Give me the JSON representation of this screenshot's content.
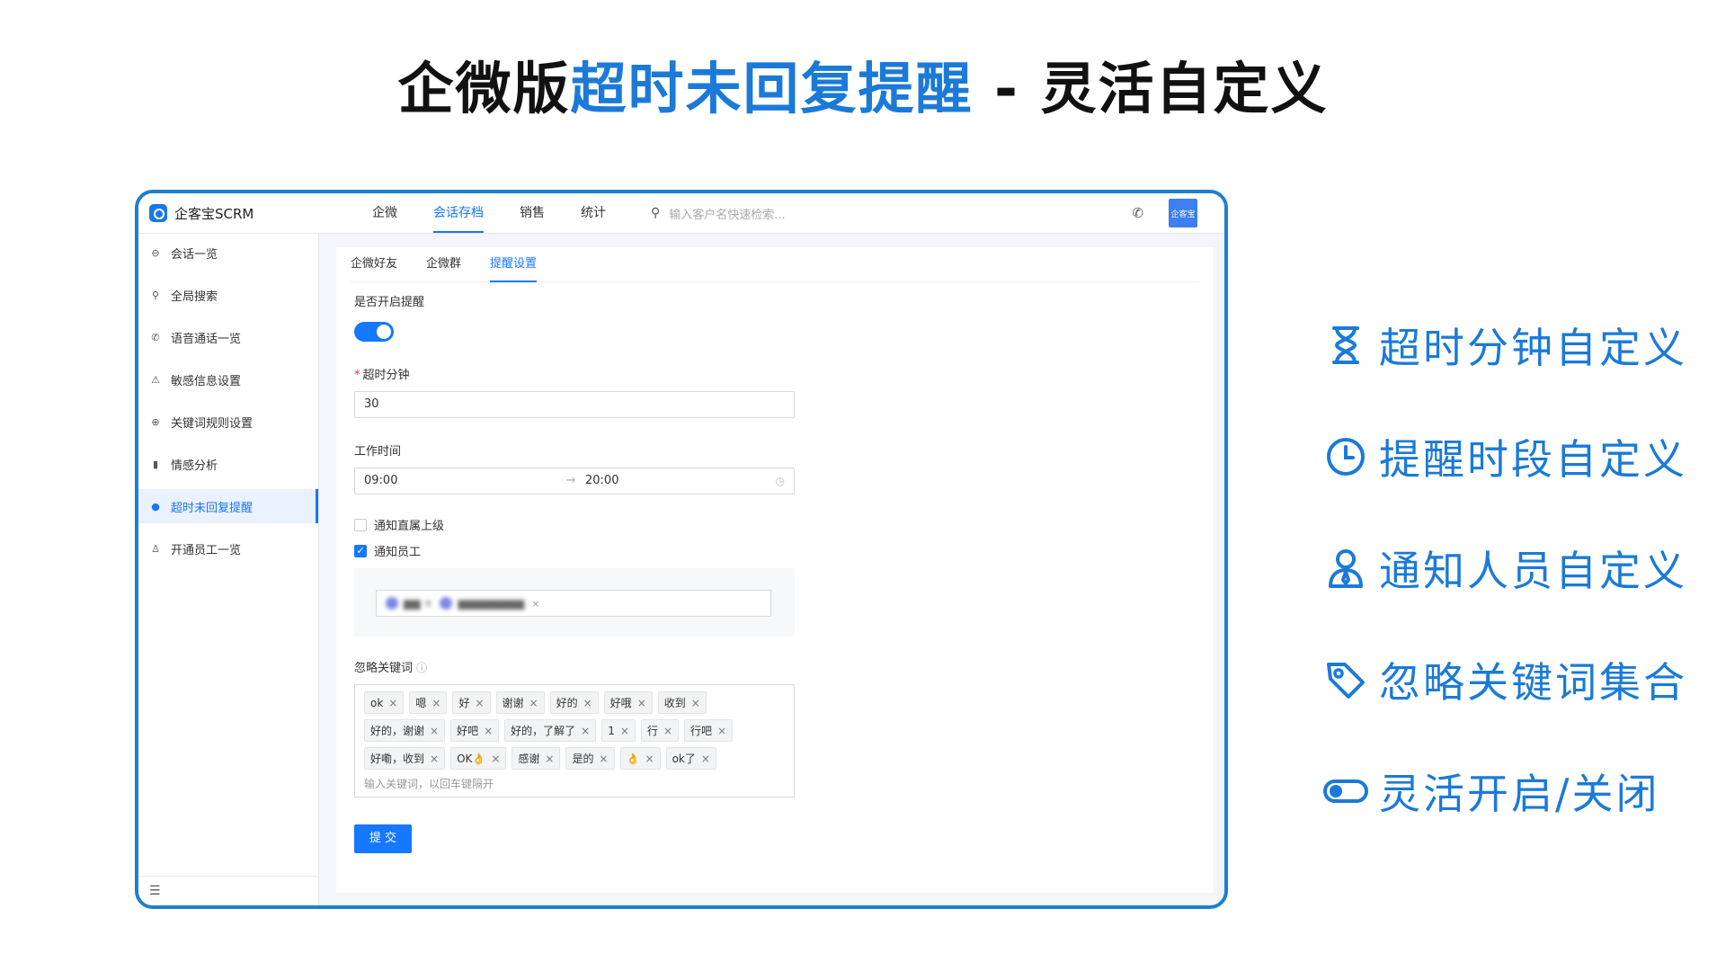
{
  "title": {
    "prefix": "企微版",
    "highlight": "超时未回复提醒",
    "suffix": " - 灵活自定义"
  },
  "app": {
    "logo_text": "企客宝SCRM",
    "top_nav": [
      "企微",
      "会话存档",
      "销售",
      "统计"
    ],
    "top_nav_active": "会话存档",
    "search_placeholder": "输入客户名快速检索...",
    "avatar_text": "企客宝"
  },
  "sidebar": {
    "items": [
      {
        "label": "会话一览",
        "icon": "chat-icon"
      },
      {
        "label": "全局搜索",
        "icon": "search-icon"
      },
      {
        "label": "语音通话一览",
        "icon": "phone-icon"
      },
      {
        "label": "敏感信息设置",
        "icon": "warning-icon"
      },
      {
        "label": "关键词规则设置",
        "icon": "keyword-search-icon"
      },
      {
        "label": "情感分析",
        "icon": "bar-chart-icon"
      },
      {
        "label": "超时未回复提醒",
        "icon": "pin-icon",
        "active": true
      },
      {
        "label": "开通员工一览",
        "icon": "user-icon"
      }
    ]
  },
  "tabs": [
    "企微好友",
    "企微群",
    "提醒设置"
  ],
  "tab_active": "提醒设置",
  "form": {
    "enable_label": "是否开启提醒",
    "enable_value": true,
    "timeout_label": "超时分钟",
    "timeout_value": "30",
    "work_time_label": "工作时间",
    "work_start": "09:00",
    "work_end": "20:00",
    "notify_superior_label": "通知直属上级",
    "notify_superior_checked": false,
    "notify_staff_label": "通知员工",
    "notify_staff_checked": true,
    "ignore_keywords_label": "忽略关键词",
    "keywords": [
      "ok",
      "嗯",
      "好",
      "谢谢",
      "好的",
      "好哦",
      "收到",
      "好的，谢谢",
      "好吧",
      "好的，了解了",
      "1",
      "行",
      "行吧",
      "好嘞，收到",
      "OK👌",
      "感谢",
      "是的",
      "👌",
      "ok了"
    ],
    "keyword_placeholder": "输入关键词，以回车键隔开",
    "submit_label": "提 交"
  },
  "features": [
    {
      "label": "超时分钟自定义",
      "icon": "hourglass-icon"
    },
    {
      "label": "提醒时段自定义",
      "icon": "clock-icon"
    },
    {
      "label": "通知人员自定义",
      "icon": "person-icon"
    },
    {
      "label": "忽略关键词集合",
      "icon": "tag-icon"
    },
    {
      "label": "灵活开启/关闭",
      "icon": "toggle-icon"
    }
  ],
  "colors": {
    "accent": "#1b7ad8",
    "primary": "#1677ff",
    "frame_border": "#1e7fd0"
  }
}
